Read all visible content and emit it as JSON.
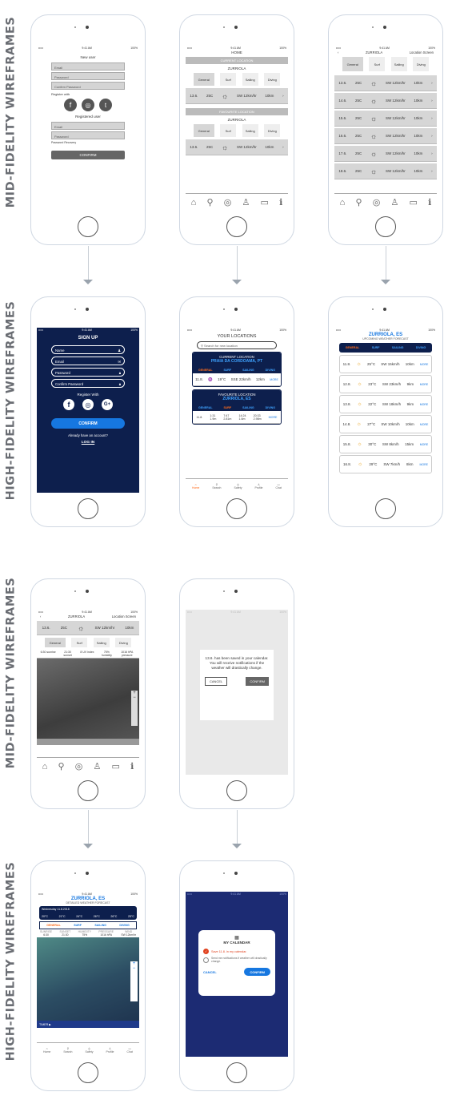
{
  "labels": {
    "mid1": "MID-FIDELITY WIREFRAMES",
    "high1": "HIGH-FIDELITY WIREFRAMES",
    "mid2": "MID-FIDELITY WIREFRAMES",
    "high2": "HIGH-FIDELITY WIREFRAMES"
  },
  "status": {
    "carrier": "•••••",
    "time": "9:41 AM",
    "battery": "100%"
  },
  "mid_signup": {
    "title": "New user",
    "fields": [
      "Email",
      "Password",
      "Confirm Password"
    ],
    "register_with": "Register with",
    "registered": "Registered user",
    "login_fields": [
      "Email",
      "Password"
    ],
    "recovery": "Password Recovery",
    "confirm": "CONFIRM"
  },
  "mid_home": {
    "title": "HOME",
    "current": "CURRENT LOCATION",
    "place": "ZURRIOLA",
    "tabs": [
      "General",
      "Surf",
      "Sailing",
      "Diving"
    ],
    "row": {
      "date": "13.6.",
      "temp": "25C",
      "wind": "SW 12km/hr",
      "vis": "10km"
    },
    "favourite": "FAVOURITE LOCATION",
    "place2": "ZURRIOLA"
  },
  "mid_list": {
    "title": "ZURRIOLA",
    "link": "Location Screen",
    "tabs": [
      "General",
      "Surf",
      "Sailing",
      "Diving"
    ],
    "dates": [
      "13.6.",
      "14.6.",
      "15.6.",
      "16.6.",
      "17.6.",
      "18.6."
    ],
    "temp": "25C",
    "wind": "SW 12km/hr",
    "vis": "10km"
  },
  "hf_signup": {
    "title": "SIGN UP",
    "fields": [
      "Name",
      "Email",
      "Password",
      "Confirm Password"
    ],
    "register_with": "Register With",
    "confirm": "CONFIRM",
    "already": "Already have an account?",
    "login": "LOG IN"
  },
  "hf_locations": {
    "title": "YOUR LOCATIONS",
    "search": "Search for new location",
    "current": "CURRENT LOCATION",
    "place": "PRAIA DA CORDOAMA, PT",
    "tabs": [
      "GENERAL",
      "SURF",
      "SAILING",
      "DIVING"
    ],
    "row": {
      "date": "11.8.",
      "temp": "19°C",
      "wind": "SSE 22km/h",
      "vis": "12km"
    },
    "favourite": "FAVOURITE LOCATION",
    "place2": "ZURRIOLA, ES",
    "tides": [
      "1:31",
      "7:47",
      "14:24",
      "20:33"
    ],
    "heights": [
      "1.9m",
      "2.81m",
      "1.6m",
      "2.98m"
    ],
    "more": "MORE",
    "nav": [
      "Home",
      "Search",
      "Safety",
      "Profile",
      "Chat"
    ]
  },
  "hf_upcoming": {
    "title": "ZURRIOLA, ES",
    "subtitle": "UPCOMING WEATHER FORECAST",
    "tabs": [
      "GENERAL",
      "SURF",
      "SAILING",
      "DIVING"
    ],
    "rows": [
      {
        "d": "11.8.",
        "t": "25°C",
        "w": "SW 15km/h",
        "v": "10km"
      },
      {
        "d": "12.8.",
        "t": "23°C",
        "w": "SW 23km/h",
        "v": "9km"
      },
      {
        "d": "13.8.",
        "t": "22°C",
        "w": "SW 18km/h",
        "v": "9km"
      },
      {
        "d": "14.8.",
        "t": "27°C",
        "w": "SW 10km/h",
        "v": "10km"
      },
      {
        "d": "15.8.",
        "t": "30°C",
        "w": "SW 8km/h",
        "v": "15km"
      },
      {
        "d": "16.8.",
        "t": "29°C",
        "w": "SW 7km/h",
        "v": "8km"
      }
    ]
  },
  "mid_detail": {
    "title": "ZURRIOLA",
    "link": "Location Screen",
    "row": {
      "date": "13.6.",
      "temp": "25C",
      "wind": "SW 12km/hr",
      "vis": "10km"
    },
    "tabs": [
      "General",
      "Surf",
      "Sailing",
      "Diving"
    ],
    "stats": [
      "6:30 sunrise",
      "21:30 sunset",
      "8 UV index",
      "75% humidity",
      "1016 hPA pressure"
    ]
  },
  "mid_dialog": {
    "text": "13.6. has been saved in your calendar. You will receive notifications if the weather will drastically change.",
    "cancel": "CANCEL",
    "confirm": "CONFIRM"
  },
  "hf_detail": {
    "title": "ZURRIOLA, ES",
    "subtitle": "DETAILED WEATHER FORECAST",
    "date": "Wednesday 11.8.2018",
    "temps": [
      "20°C",
      "21°C",
      "24°C",
      "26°C",
      "26°C",
      "25°C"
    ],
    "tabs": [
      "GENERAL",
      "SURF",
      "SAILING",
      "DIVING"
    ],
    "heads": [
      "SUNRISE",
      "SUNSET",
      "HUMIDITY",
      "PRESSURE",
      "WIND"
    ],
    "vals": [
      "6:30",
      "21:30",
      "75%",
      "1016 hPA",
      "SW 12km/hr"
    ],
    "timer": "TIMER"
  },
  "hf_dialog": {
    "title": "MY CALENDAR",
    "opt1": "Save 11.8. in my calendar.",
    "opt2": "Send me notifications if weather will drastically change.",
    "cancel": "CANCEL",
    "confirm": "CONFIRM"
  }
}
